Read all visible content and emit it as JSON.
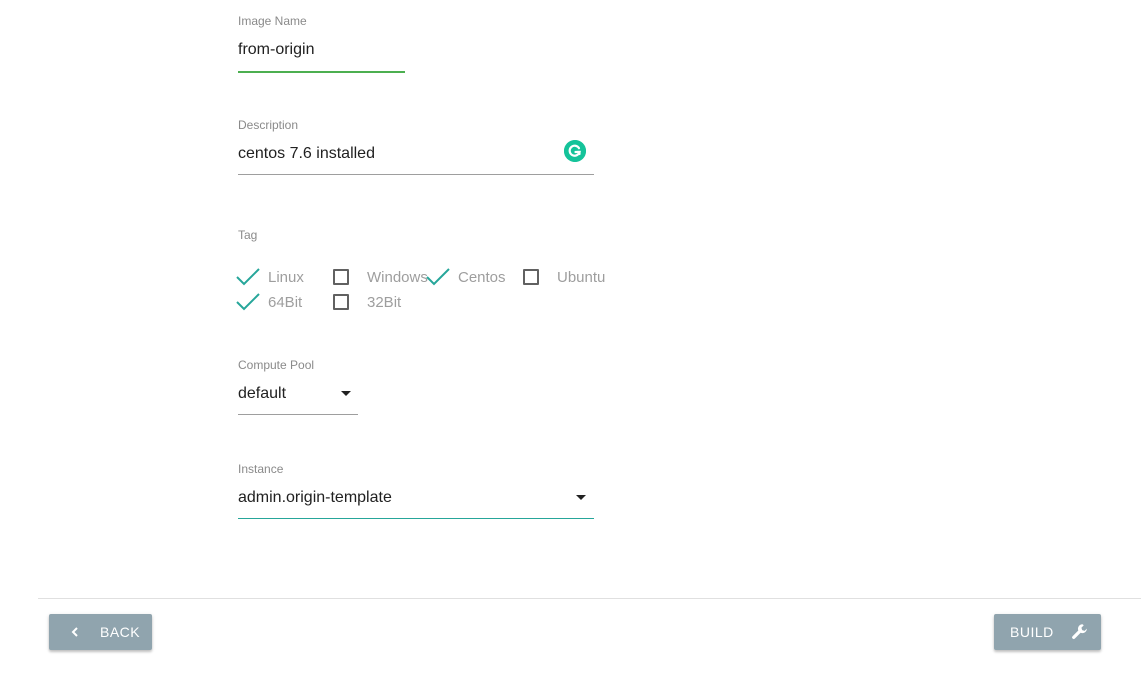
{
  "form": {
    "image_name": {
      "label": "Image Name",
      "value": "from-origin"
    },
    "description": {
      "label": "Description",
      "value": "centos 7.6 installed"
    },
    "tag": {
      "label": "Tag",
      "options": [
        {
          "label": "Linux",
          "checked": true
        },
        {
          "label": "Windows",
          "checked": false
        },
        {
          "label": "Centos",
          "checked": true
        },
        {
          "label": "Ubuntu",
          "checked": false
        },
        {
          "label": "64Bit",
          "checked": true
        },
        {
          "label": "32Bit",
          "checked": false
        }
      ]
    },
    "compute_pool": {
      "label": "Compute Pool",
      "value": "default"
    },
    "instance": {
      "label": "Instance",
      "value": "admin.origin-template"
    }
  },
  "footer": {
    "back_label": "BACK",
    "build_label": "BUILD"
  },
  "extension": {
    "grammarly_icon": "grammarly-icon",
    "grammarly_color": "#15c39a"
  },
  "colors": {
    "accent_green": "#4caf50",
    "accent_teal": "#26a69a",
    "button_bg": "#90a4ae"
  }
}
